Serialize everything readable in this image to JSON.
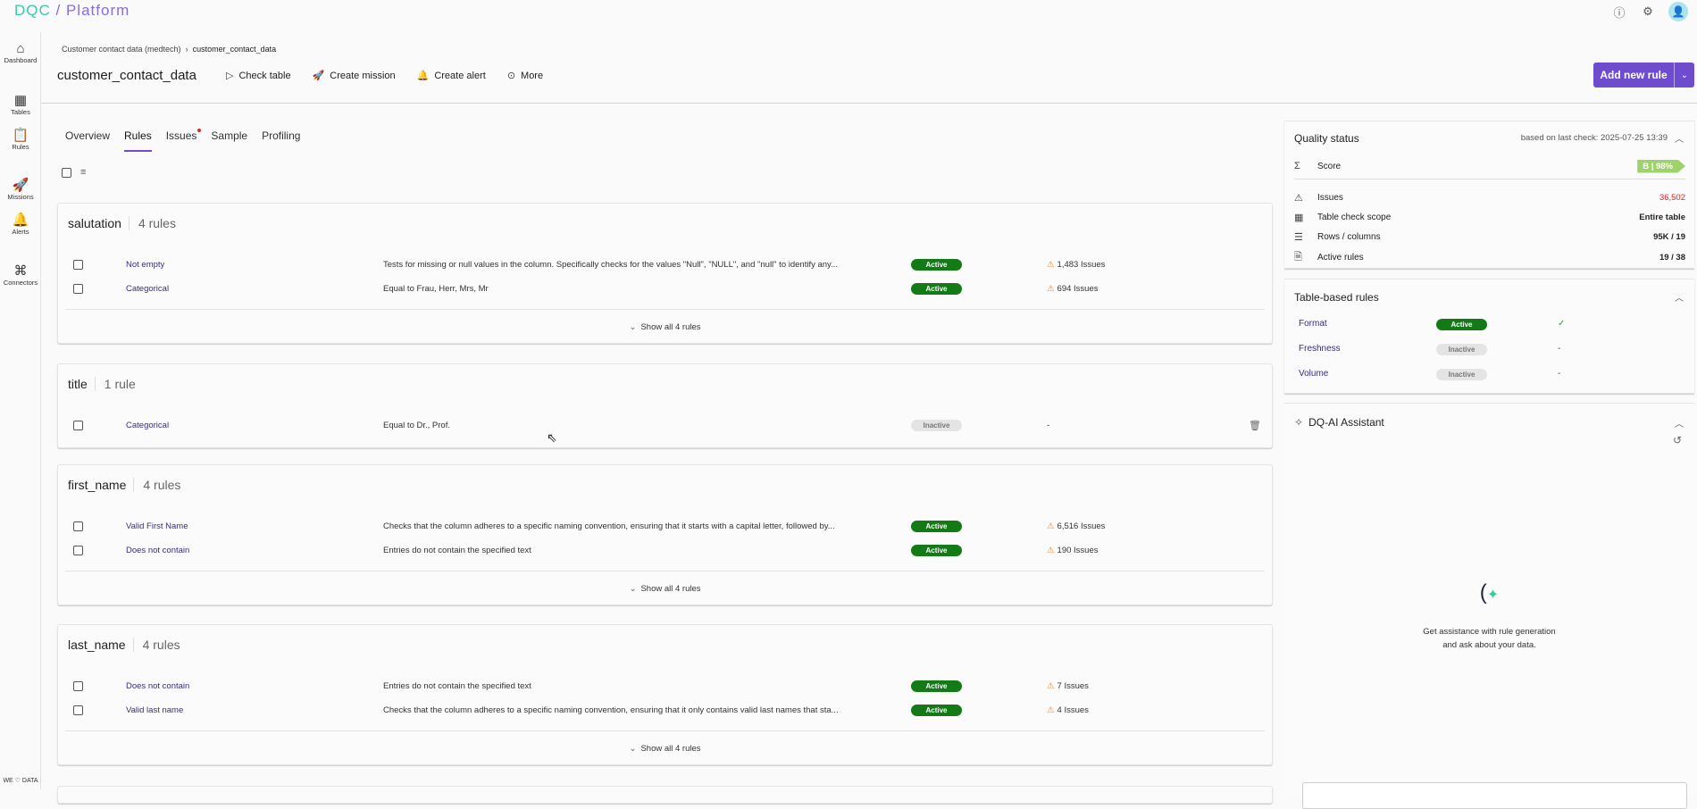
{
  "app": {
    "logo": "DQC",
    "product": "Platform"
  },
  "topbar": {
    "icons": [
      "help-icon",
      "settings-icon",
      "user-avatar"
    ]
  },
  "sidebar": {
    "items": [
      {
        "label": "Dashboard",
        "icon": "home-icon"
      },
      {
        "label": "Tables",
        "icon": "table-icon"
      },
      {
        "label": "Rules",
        "icon": "clipboard-icon"
      },
      {
        "label": "Missions",
        "icon": "rocket-icon"
      },
      {
        "label": "Alerts",
        "icon": "bell-icon"
      },
      {
        "label": "Connectors",
        "icon": "connectors-icon"
      }
    ],
    "footer": "WE ♡ DATA"
  },
  "breadcrumb": {
    "parent": "Customer contact data (medtech)",
    "current": "customer_contact_data"
  },
  "header": {
    "title": "customer_contact_data",
    "actions": [
      "Check table",
      "Create mission",
      "Create alert",
      "More"
    ],
    "add_rule": "Add new rule"
  },
  "tabs": [
    {
      "label": "Overview"
    },
    {
      "label": "Rules",
      "active": true
    },
    {
      "label": "Issues",
      "dot": true
    },
    {
      "label": "Sample"
    },
    {
      "label": "Profiling"
    }
  ],
  "groups": [
    {
      "column": "salutation",
      "count": "4 rules",
      "rules": [
        {
          "name": "Not empty",
          "desc": "Tests for missing or null values in the column. Specifically checks for the values \"Null\", \"NULL\", and \"null\" to identify any...",
          "status": "Active",
          "issues": "1,483 Issues"
        },
        {
          "name": "Categorical",
          "desc": "Equal to Frau, Herr, Mrs, Mr",
          "status": "Active",
          "issues": "694 Issues"
        }
      ],
      "show_all": "Show all 4 rules"
    },
    {
      "column": "title",
      "count": "1 rule",
      "rules": [
        {
          "name": "Categorical",
          "desc": "Equal to Dr., Prof.",
          "status": "Inactive",
          "issues": "-"
        }
      ]
    },
    {
      "column": "first_name",
      "count": "4 rules",
      "rules": [
        {
          "name": "Valid First Name",
          "desc": "Checks that the column adheres to a specific naming convention, ensuring that it starts with a capital letter, followed by...",
          "status": "Active",
          "issues": "6,516 Issues"
        },
        {
          "name": "Does not contain",
          "desc": "Entries do not contain the specified text",
          "status": "Active",
          "issues": "190 Issues"
        }
      ],
      "show_all": "Show all 4 rules"
    },
    {
      "column": "last_name",
      "count": "4 rules",
      "rules": [
        {
          "name": "Does not contain",
          "desc": "Entries do not contain the specified text",
          "status": "Active",
          "issues": "7 Issues"
        },
        {
          "name": "Valid last name",
          "desc": "Checks that the column adheres to a specific naming convention, ensuring that it only contains valid last names that sta...",
          "status": "Active",
          "issues": "4 Issues"
        }
      ],
      "show_all": "Show all 4 rules"
    }
  ],
  "quality": {
    "title": "Quality status",
    "last_check": "based on last check: 2025-07-25 13:39",
    "score_label": "Score",
    "score": "B | 98%",
    "rows": [
      {
        "label": "Issues",
        "value": "36,502",
        "color": "#e02424"
      },
      {
        "label": "Table check scope",
        "value": "Entire table"
      },
      {
        "label": "Rows / columns",
        "value": "95K / 19"
      },
      {
        "label": "Active rules",
        "value": "19 / 38"
      }
    ]
  },
  "table_rules": {
    "title": "Table-based rules",
    "items": [
      {
        "name": "Format",
        "status": "Active",
        "result": "✓"
      },
      {
        "name": "Freshness",
        "status": "Inactive",
        "result": "-"
      },
      {
        "name": "Volume",
        "status": "Inactive",
        "result": "-"
      }
    ]
  },
  "assistant": {
    "title": "DQ-AI Assistant",
    "line1": "Get assistance with rule generation",
    "line2": "and ask about your data."
  },
  "colors": {
    "accent": "#6f4ccd",
    "active": "#137a16",
    "warning": "#f08a3c"
  }
}
